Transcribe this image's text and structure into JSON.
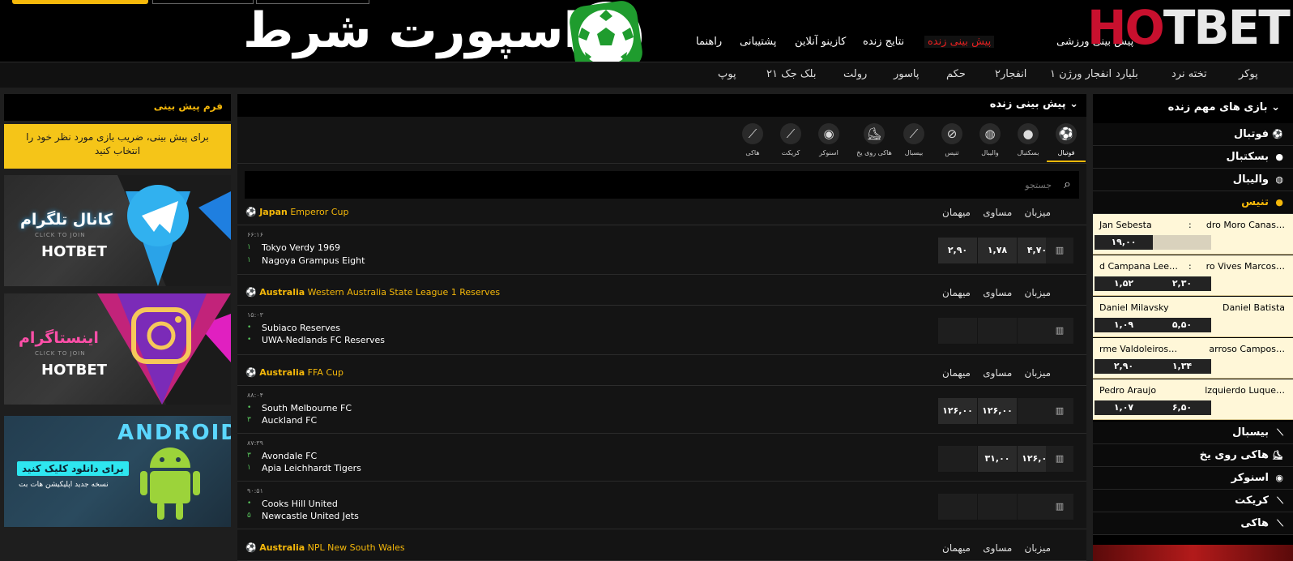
{
  "brand": {
    "logo_left": "H",
    "logo_o": "O",
    "logo_right": "TBET",
    "banner_text": "اسپورت شرط"
  },
  "topnav": [
    "پیش بینی ورزشی",
    "پیش بینی زنده",
    "نتایج زنده",
    "کازینو آنلاین",
    "پشتیبانی",
    "راهنما"
  ],
  "menu": [
    "پوکر",
    "تخته نرد",
    "بلیارد",
    "انفجار ورژن ۱",
    "انفجار۲",
    "حکم",
    "پاسور",
    "رولت",
    "بلک جک ۲۱",
    "پوپ"
  ],
  "right_panel": {
    "title": "بازی های مهم زنده",
    "sports_top": [
      "فوتبال",
      "بسکتبال",
      "والیبال"
    ],
    "active_sport": "تنیس",
    "matches": [
      {
        "home": "dro Moro Canas…",
        "away": "Jan Sebesta",
        "colon": ":",
        "odd1": "",
        "odd2": "۱۹,۰۰"
      },
      {
        "home": "ro Vives Marcos…",
        "away": "d Campana Lee…",
        "colon": ":",
        "odd1": "۲,۳۰",
        "odd2": "۱,۵۲"
      },
      {
        "home": "Daniel Batista",
        "away": "Daniel Milavsky",
        "colon": "",
        "odd1": "۵,۵۰",
        "odd2": "۱,۰۹"
      },
      {
        "home": "arroso Campos…",
        "away": "rme Valdoleiros…",
        "colon": "",
        "odd1": "۱,۳۴",
        "odd2": "۲,۹۰"
      },
      {
        "home": "lzquierdo Luque…",
        "away": "Pedro Araujo",
        "colon": "",
        "odd1": "۶,۵۰",
        "odd2": "۱,۰۷"
      }
    ],
    "sports_bottom": [
      "بیسبال",
      "هاکی روی یخ",
      "اسنوکر",
      "کریکت",
      "هاکی"
    ]
  },
  "center": {
    "title": "پیش بینی زنده",
    "tabs": [
      "فوتبال",
      "بسکتبال",
      "والیبال",
      "تنیس",
      "بیسبال",
      "هاکی روی یخ",
      "اسنوکر",
      "کریکت",
      "هاکی"
    ],
    "search_placeholder": "جستجو",
    "col_away": "میهمان",
    "col_draw": "مساوی",
    "col_home": "میزبان",
    "leagues": [
      {
        "country": "Japan",
        "name": "Emperor Cup"
      },
      {
        "country": "Australia",
        "name": "Western Australia State League 1 Reserves"
      },
      {
        "country": "Australia",
        "name": "FFA Cup"
      },
      {
        "country": "Australia",
        "name": "NPL New South Wales"
      }
    ],
    "matches": [
      {
        "time": "۶۶:۱۶",
        "team1": "Tokyo Verdy 1969",
        "team2": "Nagoya Grampus Eight",
        "s1": "۱",
        "s2": "۱",
        "o_away": "۴,۷۰",
        "o_draw": "۱,۷۸",
        "o_home": "۲,۹۰"
      },
      {
        "time": "۱۵:۰۳",
        "team1": "Subiaco Reserves",
        "team2": "UWA-Nedlands FC Reserves",
        "s1": "•",
        "s2": "•",
        "o_away": "",
        "o_draw": "",
        "o_home": ""
      },
      {
        "time": "۸۸:۰۴",
        "team1": "South Melbourne FC",
        "team2": "Auckland FC",
        "s1": "•",
        "s2": "۳",
        "o_away": "",
        "o_draw": "۱۲۶,۰۰",
        "o_home": "۱۲۶,۰۰"
      },
      {
        "time": "۸۷:۳۹",
        "team1": "Avondale FC",
        "team2": "Apia Leichhardt Tigers",
        "s1": "۳",
        "s2": "۱",
        "o_away": "۱۲۶,۰۰",
        "o_draw": "۳۱,۰۰",
        "o_home": ""
      },
      {
        "time": "۹۰:۵۱",
        "team1": "Cooks Hill United",
        "team2": "Newcastle United Jets",
        "s1": "•",
        "s2": "۵",
        "o_away": "",
        "o_draw": "",
        "o_home": ""
      }
    ]
  },
  "left": {
    "title": "فرم پیش بینی",
    "hint": "برای پیش بینی، ضریب بازی مورد نظر خود را انتخاب کنید",
    "banner1": "کانال تلگرام",
    "banner1_sub": "CLICK TO JOIN",
    "banner2": "اینستاگرام",
    "banner2_sub": "CLICK TO JOIN",
    "banner_brand": "HOTBET",
    "banner3": "ANDROID",
    "banner3_btn": "برای دانلود کلیک کنید",
    "banner3_sub": "نسخه جدید اپلیکیشن هات بت"
  }
}
